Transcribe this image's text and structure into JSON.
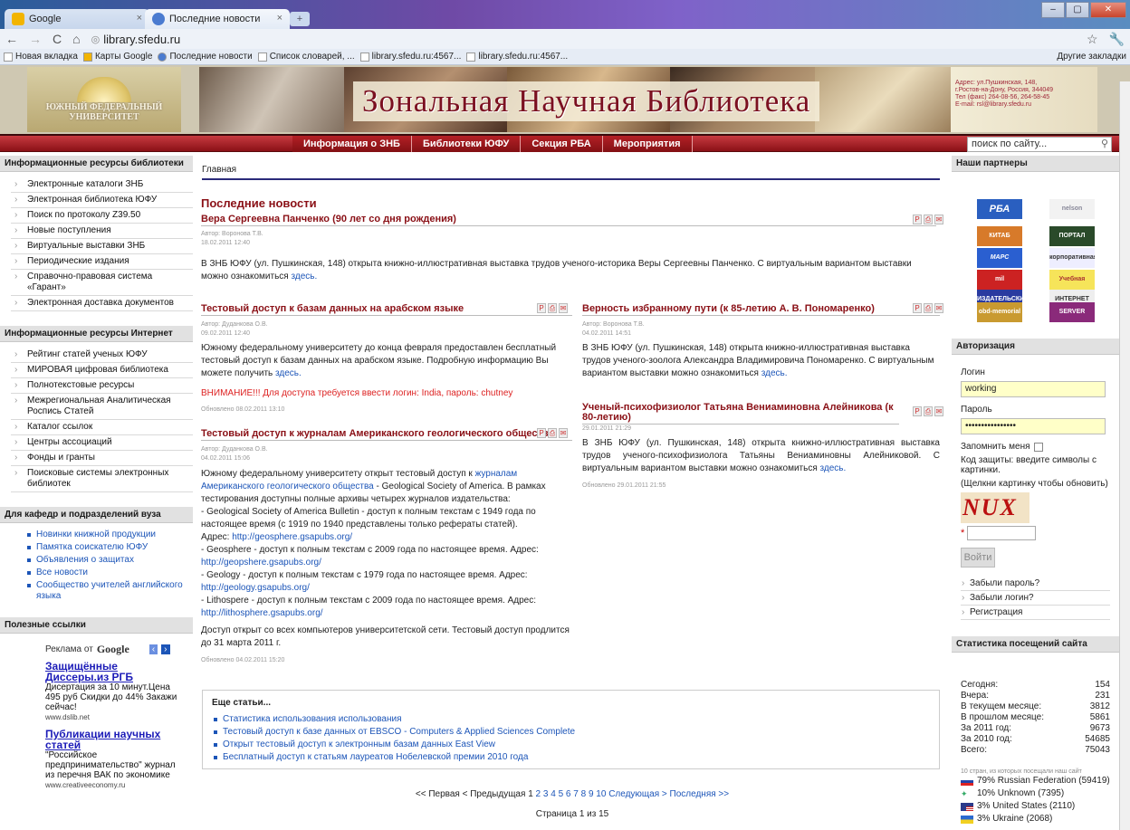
{
  "browser": {
    "tabs": [
      {
        "label": "Google",
        "icon_color": "#f2b400"
      },
      {
        "label": "Последние новости",
        "icon_color": "#4a7bd0"
      }
    ],
    "url": "library.sfedu.ru",
    "bookmarks": [
      "Новая вкладка",
      "Карты Google",
      "Последние новости",
      "Список словарей, ...",
      "library.sfedu.ru:4567...",
      "library.sfedu.ru:4567..."
    ],
    "other_bookmarks": "Другие закладки"
  },
  "banner": {
    "logo_text": "ЮЖНЫЙ ФЕДЕРАЛЬНЫЙ УНИВЕРСИТЕТ",
    "title": "Зональная Научная Библиотека",
    "address": [
      "Адрес: ул.Пушкинская, 148,",
      "г.Ростов-на-Дону, Россия, 344049",
      "Тел (факс) 264-08-56, 264-58-45",
      "E-mail: rsl@library.sfedu.ru"
    ]
  },
  "menu": {
    "items": [
      "Информация о ЗНБ",
      "Библиотеки ЮФУ",
      "Секция РБА",
      "Мероприятия"
    ],
    "search_placeholder": "поиск по сайту..."
  },
  "left": {
    "sec1": {
      "title": "Информационные ресурсы библиотеки",
      "items": [
        "Электронные каталоги ЗНБ",
        "Электронная библиотека ЮФУ",
        "Поиск по протоколу Z39.50",
        "Новые поступления",
        "Виртуальные выставки ЗНБ",
        "Периодические издания",
        "Справочно-правовая система «Гарант»",
        "Электронная доставка документов"
      ]
    },
    "sec2": {
      "title": "Информационные ресурсы Интернет",
      "items": [
        "Рейтинг статей ученых ЮФУ",
        "МИРОВАЯ цифровая библиотека",
        "Полнотекстовые ресурсы",
        "Межрегиональная Аналитическая Роспись Статей",
        "Каталог ссылок",
        "Центры ассоциаций",
        "Фонды и гранты",
        "Поисковые системы электронных библиотек"
      ]
    },
    "sec3": {
      "title": "Для кафедр и подразделений вуза",
      "items": [
        "Новинки книжной продукции",
        "Памятка соискателю ЮФУ",
        "Объявления о защитах",
        "Все новости",
        "Сообщество учителей английского языка"
      ]
    },
    "sec4": {
      "title": "Полезные ссылки"
    },
    "ad": {
      "label": "Реклама от",
      "google": "Google",
      "ads": [
        {
          "title": "Защищённые Диссеры.из РГБ",
          "text": "Дисертация за 10 минут.Цена 495 руб Скидки до 44% Закажи сейчас!",
          "url": "www.dslib.net"
        },
        {
          "title": "Публикации научных статей",
          "text": "\"Российское предпринимательство\" журнал из перечня ВАК по экономике",
          "url": "www.creativeeconomy.ru"
        }
      ]
    }
  },
  "main": {
    "breadcrumb": "Главная",
    "heading": "Последние новости",
    "a1": {
      "title": "Вера Сергеевна Панченко (90 лет со дня рождения)",
      "author": "Автор: Воронова Т.В.",
      "date": "18.02.2011 12:40",
      "body": "В ЗНБ ЮФУ (ул. Пушкинская, 148) открыта книжно-иллюстративная выставка трудов ученого-историка Веры Сергеевны Панченко. С виртуальным вариантом выставки можно ознакомиться ",
      "link": "здесь."
    },
    "a2": {
      "title": "Тестовый доступ к базам данных на арабском языке",
      "author": "Автор: Дуданкова О.В.",
      "date": "09.02.2011 12:40",
      "body": "Южному федеральному университету до конца февраля предоставлен бесплатный тестовый доступ к базам данных на арабском языке. Подробную информацию Вы можете получить ",
      "link": "здесь.",
      "warn": "ВНИМАНИЕ!!! Для доступа требуется ввести логин: India, пароль: chutney",
      "updated": "Обновлено 08.02.2011 13:10"
    },
    "a3": {
      "title": "Тестовый доступ к журналам Американского геологического общества",
      "author": "Автор: Дуданкова О.В.",
      "date": "04.02.2011 15:06",
      "p1a": "Южному федеральному университету открыт тестовый доступ к ",
      "p1link": "журналам Американского геологического общества",
      "p1b": " - Geological Society of America. В рамках тестирования доступны полные архивы четырех журналов издательства:",
      "l1": "- Geological Society of America Bulletin - доступ к полным текстам с 1949 года по настоящее время (с 1919 по 1940 представлены только рефераты статей).",
      "l1addr": "Адрес: ",
      "l1url": "http://geosphere.gsapubs.org/",
      "l2": "- Geosphere - доступ к полным текстам с 2009 года по настоящее время. Адрес:",
      "l2url": "http://geopshere.gsapubs.org/",
      "l3": "- Geology - доступ к полным текстам с 1979 года по настоящее время. Адрес:",
      "l3url": "http://geology.gsapubs.org/",
      "l4": "- Lithospere - доступ к полным текстам с 2009 года по настоящее время. Адрес:",
      "l4url": "http://lithosphere.gsapubs.org/",
      "p2": "Доступ открыт со всех компьютеров университетской сети. Тестовый доступ продлится до 31 марта 2011 г.",
      "updated": "Обновлено 04.02.2011 15:20"
    },
    "a4": {
      "title": "Верность избранному пути (к 85-летию А. В. Пономаренко)",
      "author": "Автор: Воронова Т.В.",
      "date": "04.02.2011 14:51",
      "body": "В ЗНБ ЮФУ (ул. Пушкинская, 148) открыта книжно-иллюстративная выставка трудов ученого-зоолога Александра Владимировича Пономаренко. С виртуальным вариантом выставки можно ознакомиться ",
      "link": "здесь."
    },
    "a5": {
      "title": "Ученый-психофизиолог Татьяна Вениаминовна Алейникова (к 80-летию)",
      "date": "29.01.2011 21:29",
      "body": "В ЗНБ ЮФУ (ул. Пушкинская, 148) открыта книжно-иллюстративная выставка трудов ученого-психофизиолога Татьяны Вениаминовны Алейниковой. С виртуальным вариантом выставки можно ознакомиться ",
      "link": "здесь.",
      "updated": "Обновлено 29.01.2011 21:55"
    },
    "more": {
      "title": "Еще статьи...",
      "items": [
        "Статистика использования использования",
        "Тестовый доступ к базе данных от EBSCO - Computers & Applied Sciences Complete",
        "Открыт тестовый доступ к электронным базам данных East View",
        "Бесплатный доступ к статьям лауреатов Нобелевской премии 2010 года"
      ]
    },
    "pager": {
      "first": "<< Первая",
      "prev": "< Предыдущая",
      "current": "1",
      "pages": [
        "2",
        "3",
        "4",
        "5",
        "6",
        "7",
        "8",
        "9",
        "10"
      ],
      "next": "Следующая >",
      "last": "Последняя >>",
      "pageof": "Страница 1 из 15"
    }
  },
  "right": {
    "partners_title": "Наши партнеры",
    "partners": [
      "РБА",
      "nelson",
      "КИТАБ",
      "ПОРТАЛ LIBRARY.RU",
      "МАРС",
      "корпоративная сеть",
      "mil",
      "Учебная литература",
      "ИЗДАТЕЛЬСКИЙ ДОМ ГУ ВШЭ",
      "ИНТЕРНЕТ",
      "obd-memorial",
      "SERVER"
    ],
    "auth_title": "Авторизация",
    "login_label": "Логин",
    "login_value": "working",
    "pass_label": "Пароль",
    "pass_value": "••••••••••••••••",
    "remember": "Запомнить меня",
    "code_label": "Код защиты: введите символы с картинки.",
    "code_hint": "(Щелкни картинку чтобы обновить)",
    "captcha": "NUX",
    "req": "*",
    "login_btn": "Войти",
    "links": [
      "Забыли пароль?",
      "Забыли логин?",
      "Регистрация"
    ],
    "stats_title": "Статистика посещений сайта",
    "stats": [
      {
        "k": "Сегодня:",
        "v": "154"
      },
      {
        "k": "Вчера:",
        "v": "231"
      },
      {
        "k": "В текущем месяце:",
        "v": "3812"
      },
      {
        "k": "В прошлом месяце:",
        "v": "5861"
      },
      {
        "k": "За 2011 год:",
        "v": "9673"
      },
      {
        "k": "За 2010 год:",
        "v": "54685"
      },
      {
        "k": "Всего:",
        "v": "75043"
      }
    ],
    "geo_title": "10 стран, из которых посещали наш сайт",
    "geo": [
      "79% Russian Federation (59419)",
      "10% Unknown (7395)",
      "3% United States (2110)",
      "3% Ukraine (2068)"
    ]
  }
}
